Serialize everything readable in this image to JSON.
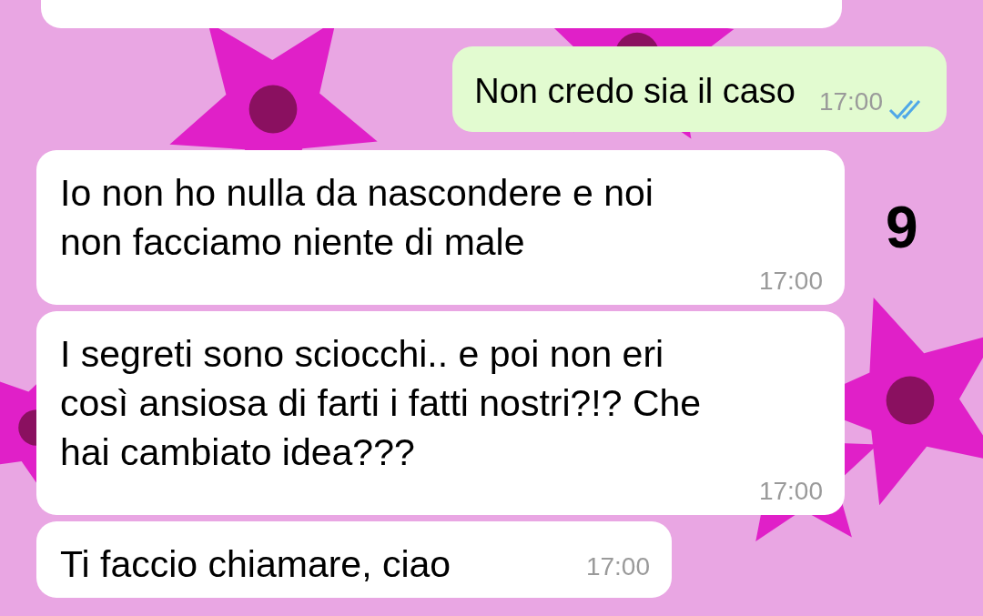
{
  "messages": [
    {
      "kind": "cut"
    },
    {
      "kind": "outgoing",
      "text": "Non credo sia il caso",
      "time": "17:00",
      "read": true
    },
    {
      "kind": "incoming",
      "text": "Io non ho nulla da nascondere e noi non facciamo niente di male",
      "time": "17:00",
      "note": "9"
    },
    {
      "kind": "incoming",
      "text": "I segreti sono sciocchi.. e poi non eri così ansiosa di farti i fatti nostri?!? Che hai cambiato idea???",
      "time": "17:00"
    },
    {
      "kind": "incoming",
      "text": "Ti faccio chiamare, ciao",
      "time": "17:00",
      "fit": true
    }
  ]
}
